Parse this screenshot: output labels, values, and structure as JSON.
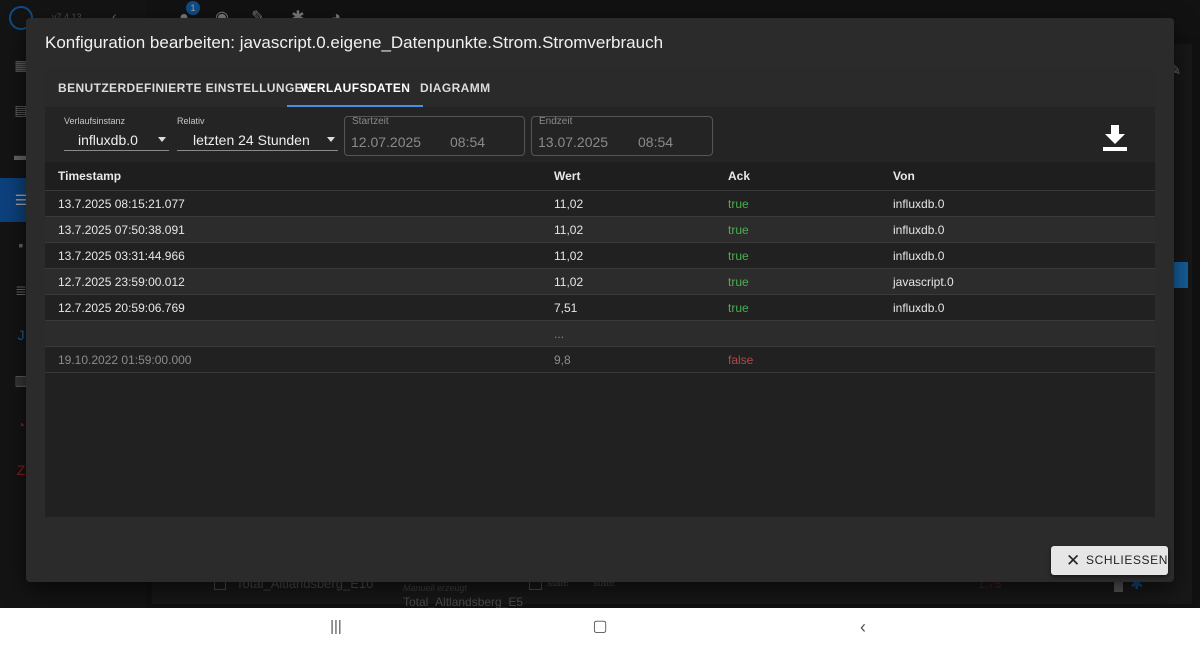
{
  "background": {
    "version": "v7.4.13",
    "notification_count": "1",
    "row_name": "Total_Altlandsberg_E10",
    "row_note": "Manuell erzeugt",
    "row_sub": "Total_Altlandsberg_E5",
    "row_role": "state",
    "row_type": "state",
    "row_value": "1,75"
  },
  "dialog": {
    "title": "Konfiguration bearbeiten: javascript.0.eigene_Datenpunkte.Strom.Stromverbrauch",
    "tabs": [
      {
        "label": "Benutzerdefinierte Einstellungen",
        "active": false
      },
      {
        "label": "Verlaufsdaten",
        "active": true
      },
      {
        "label": "Diagramm",
        "active": false
      }
    ],
    "filters": {
      "instance_label": "Verlaufsinstanz",
      "instance_value": "influxdb.0",
      "relative_label": "Relativ",
      "relative_value": "letzten 24 Stunden",
      "start_label": "Startzeit",
      "start_date": "12.07.2025",
      "start_time": "08:54",
      "end_label": "Endzeit",
      "end_date": "13.07.2025",
      "end_time": "08:54"
    },
    "table": {
      "columns": [
        "Timestamp",
        "Wert",
        "Ack",
        "Von"
      ],
      "rows": [
        {
          "timestamp": "13.7.2025 08:15:21.077",
          "value": "11,02",
          "ack": "true",
          "from": "influxdb.0"
        },
        {
          "timestamp": "13.7.2025 07:50:38.091",
          "value": "11,02",
          "ack": "true",
          "from": "influxdb.0"
        },
        {
          "timestamp": "13.7.2025 03:31:44.966",
          "value": "11,02",
          "ack": "true",
          "from": "influxdb.0"
        },
        {
          "timestamp": "12.7.2025 23:59:00.012",
          "value": "11,02",
          "ack": "true",
          "from": "javascript.0"
        },
        {
          "timestamp": "12.7.2025 20:59:06.769",
          "value": "7,51",
          "ack": "true",
          "from": "influxdb.0"
        },
        {
          "timestamp": "",
          "value": "...",
          "ack": "",
          "from": ""
        },
        {
          "timestamp": "19.10.2022 01:59:00.000",
          "value": "9,8",
          "ack": "false",
          "from": ""
        }
      ]
    },
    "close_label": "Schliessen"
  },
  "colors": {
    "accent": "#4a90e2",
    "ack_true": "#4caf50",
    "ack_false": "#b04a4a",
    "sidebar_active": "#1565c0"
  }
}
